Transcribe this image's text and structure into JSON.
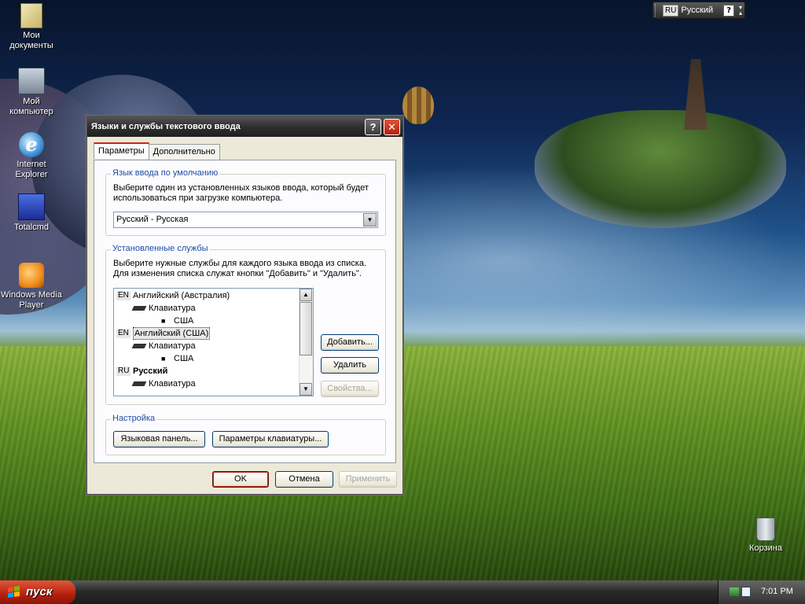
{
  "desktop": {
    "icons": [
      {
        "label": "Мои документы"
      },
      {
        "label": "Мой компьютер"
      },
      {
        "label": "Internet Explorer"
      },
      {
        "label": "Totalcmd"
      },
      {
        "label": "Windows Media Player"
      },
      {
        "label": "Корзина"
      }
    ]
  },
  "langbar": {
    "code": "RU",
    "language": "Русский",
    "help": "?"
  },
  "dialog": {
    "title": "Языки и службы текстового ввода",
    "help_glyph": "?",
    "close_glyph": "✕",
    "tabs": [
      {
        "label": "Параметры",
        "active": true
      },
      {
        "label": "Дополнительно",
        "active": false
      }
    ],
    "default_group": {
      "legend": "Язык ввода по умолчанию",
      "description": "Выберите один из установленных языков ввода, который будет использоваться при загрузке компьютера.",
      "selected": "Русский - Русская"
    },
    "services_group": {
      "legend": "Установленные службы",
      "description": "Выберите нужные службы для каждого языка ввода из списка. Для изменения списка служат кнопки \"Добавить\" и \"Удалить\".",
      "items": [
        {
          "kind": "lang",
          "code": "EN",
          "text": "Английский (Австралия)"
        },
        {
          "kind": "kb",
          "text": "Клавиатура"
        },
        {
          "kind": "layout",
          "text": "США"
        },
        {
          "kind": "lang",
          "code": "EN",
          "text": "Английский (США)",
          "selected": true
        },
        {
          "kind": "kb",
          "text": "Клавиатура"
        },
        {
          "kind": "layout",
          "text": "США"
        },
        {
          "kind": "lang",
          "code": "RU",
          "text": "Русский",
          "bold": true
        },
        {
          "kind": "kb",
          "text": "Клавиатура"
        }
      ],
      "buttons": {
        "add": "Добавить...",
        "remove": "Удалить",
        "properties": "Свойства..."
      }
    },
    "settings_group": {
      "legend": "Настройка",
      "language_bar": "Языковая панель...",
      "key_settings": "Параметры клавиатуры..."
    },
    "footer": {
      "ok": "OK",
      "cancel": "Отмена",
      "apply": "Применить"
    }
  },
  "taskbar": {
    "start_label": "пуск",
    "clock": "7:01 PM"
  }
}
